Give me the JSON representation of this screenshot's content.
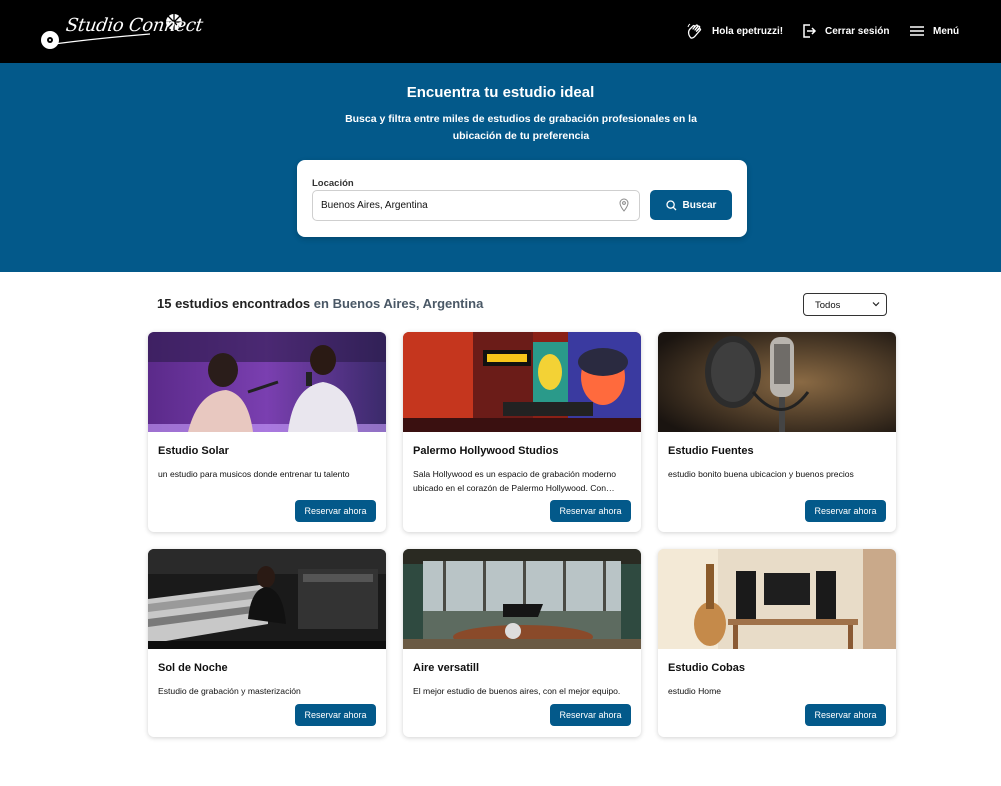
{
  "header": {
    "logo_text": "Studio Connect",
    "greeting": "Hola epetruzzi!",
    "logout": "Cerrar sesión",
    "menu": "Menú"
  },
  "hero": {
    "title": "Encuentra tu estudio ideal",
    "subtitle": "Busca y filtra entre miles de estudios de grabación profesionales en la ubicación de tu preferencia"
  },
  "search": {
    "label": "Locación",
    "value": "Buenos Aires, Argentina",
    "button": "Buscar"
  },
  "results": {
    "count_text": "15 estudios encontrados",
    "location_text": "en Buenos Aires, Argentina",
    "filter_selected": "Todos"
  },
  "colors": {
    "primary": "#03598a",
    "header_bg": "#000000"
  },
  "studios": [
    {
      "name": "Estudio Solar",
      "description": "un estudio para musicos donde entrenar tu talento",
      "button": "Reservar ahora"
    },
    {
      "name": "Palermo Hollywood Studios",
      "description": "Sala Hollywood es un espacio de grabación moderno ubicado en el corazón de Palermo Hollywood. Con…",
      "button": "Reservar ahora"
    },
    {
      "name": "Estudio Fuentes",
      "description": "estudio bonito buena ubicacion y buenos precios",
      "button": "Reservar ahora"
    },
    {
      "name": "Sol de Noche",
      "description": "Estudio de grabación y masterización",
      "button": "Reservar ahora"
    },
    {
      "name": "Aire versatill",
      "description": "El mejor estudio de buenos aires, con el mejor equipo.",
      "button": "Reservar ahora"
    },
    {
      "name": "Estudio Cobas",
      "description": "estudio Home",
      "button": "Reservar ahora"
    }
  ]
}
